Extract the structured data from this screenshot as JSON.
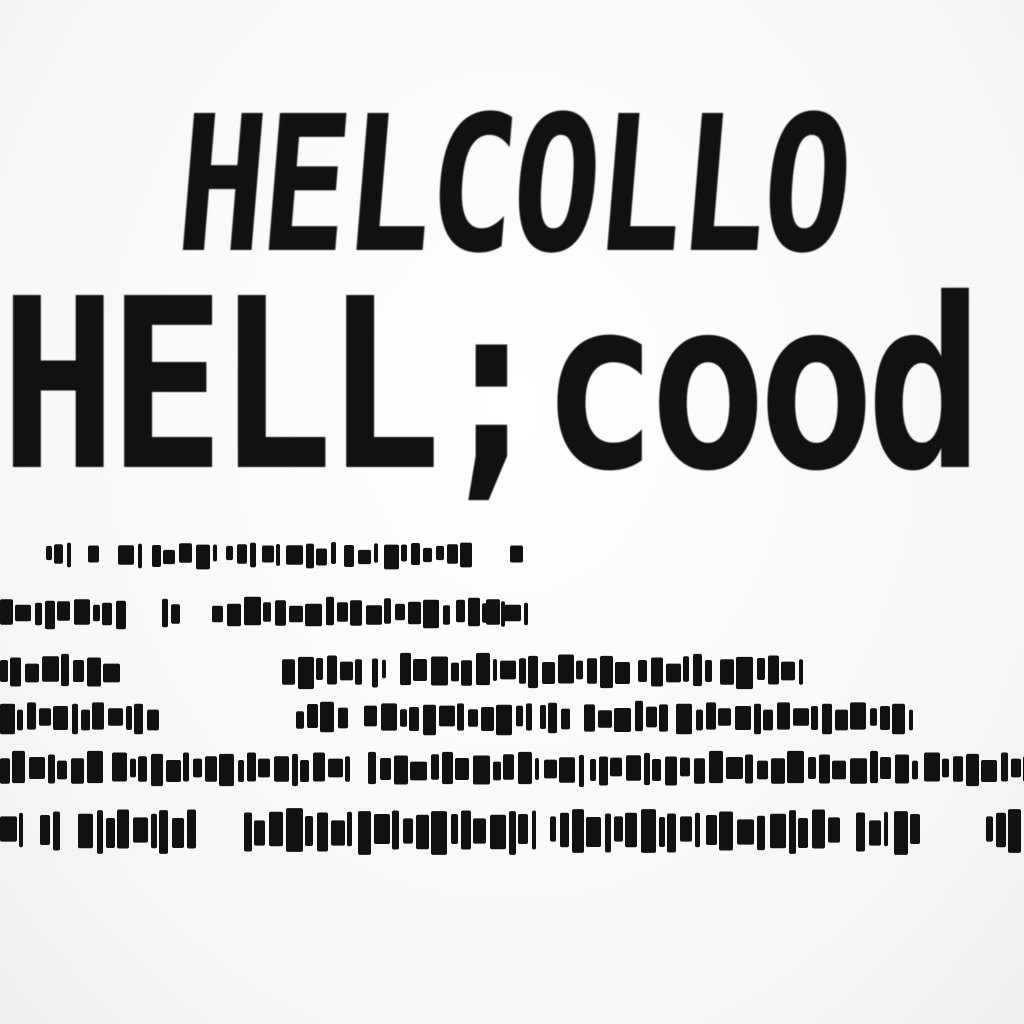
{
  "headline": {
    "line_1": "HELCOLLO",
    "line_2": "HELL;cood"
  },
  "colors": {
    "ink": "#111111",
    "paper": "#ffffff"
  },
  "illegible_text_rows": 6
}
